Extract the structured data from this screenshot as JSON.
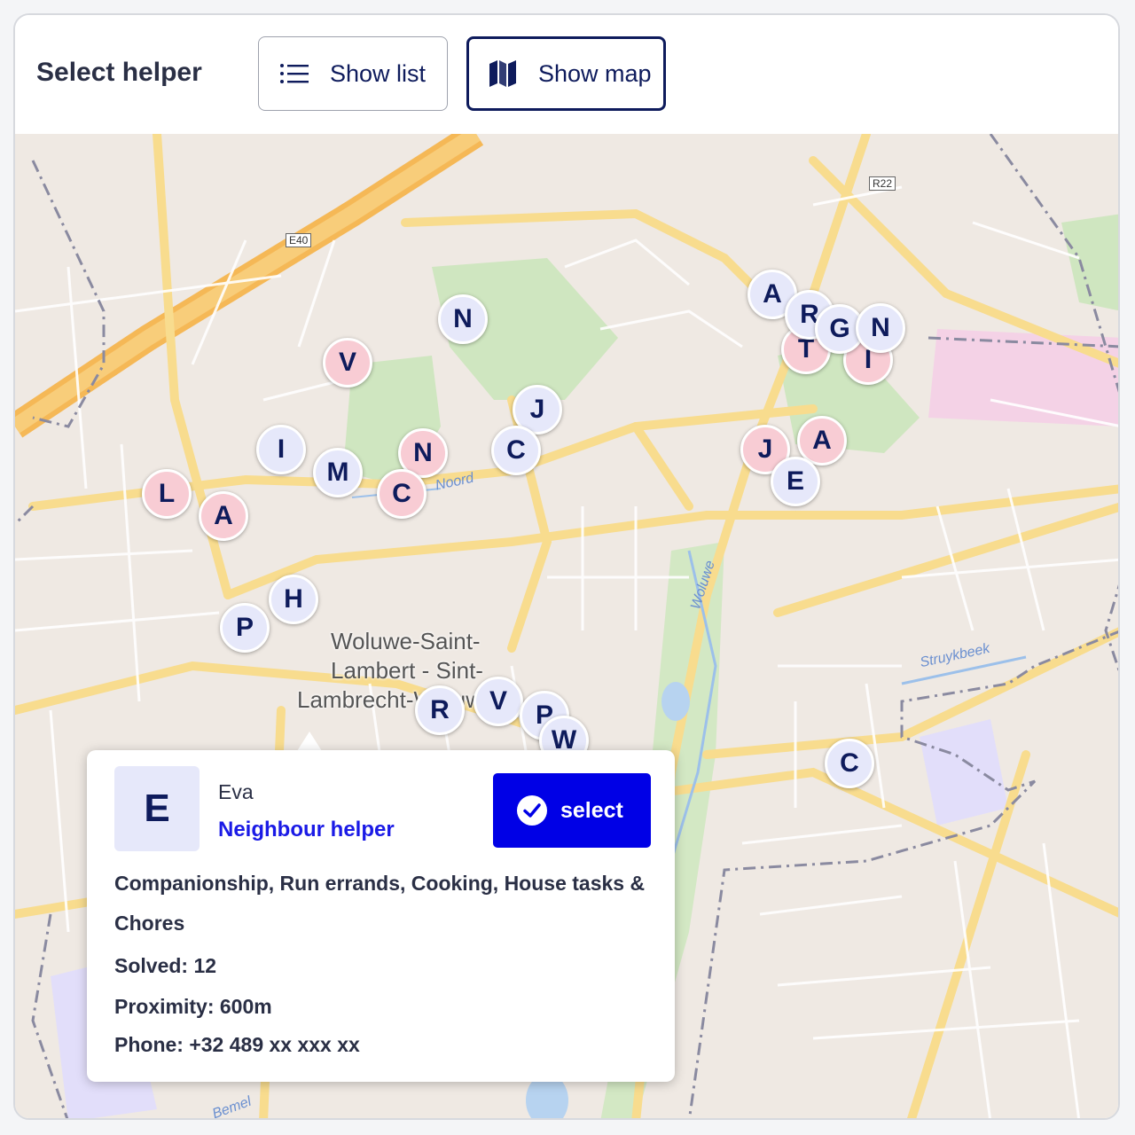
{
  "header": {
    "title": "Select helper",
    "show_list_label": "Show list",
    "show_map_label": "Show map"
  },
  "map": {
    "place_label_line1": "Woluwe-Saint-",
    "place_label_line2": "Lambert - Sint-",
    "place_label_line3": "Lambrecht-Woluwe",
    "road_tags": [
      "E40",
      "R22"
    ],
    "water_labels": [
      "Noord",
      "Woluwe",
      "Struykbeek",
      "Bemel"
    ]
  },
  "markers": [
    {
      "letter": "N",
      "color": "blue"
    },
    {
      "letter": "V",
      "color": "pink"
    },
    {
      "letter": "J",
      "color": "blue"
    },
    {
      "letter": "C",
      "color": "blue"
    },
    {
      "letter": "I",
      "color": "blue"
    },
    {
      "letter": "N",
      "color": "pink"
    },
    {
      "letter": "M",
      "color": "blue"
    },
    {
      "letter": "C",
      "color": "pink"
    },
    {
      "letter": "L",
      "color": "pink"
    },
    {
      "letter": "A",
      "color": "pink"
    },
    {
      "letter": "H",
      "color": "blue"
    },
    {
      "letter": "P",
      "color": "blue"
    },
    {
      "letter": "A",
      "color": "blue"
    },
    {
      "letter": "T",
      "color": "pink"
    },
    {
      "letter": "I",
      "color": "pink"
    },
    {
      "letter": "R",
      "color": "blue"
    },
    {
      "letter": "G",
      "color": "blue"
    },
    {
      "letter": "N",
      "color": "blue"
    },
    {
      "letter": "J",
      "color": "pink"
    },
    {
      "letter": "A",
      "color": "pink"
    },
    {
      "letter": "E",
      "color": "blue"
    },
    {
      "letter": "R",
      "color": "blue"
    },
    {
      "letter": "V",
      "color": "blue"
    },
    {
      "letter": "P",
      "color": "blue"
    },
    {
      "letter": "W",
      "color": "blue"
    },
    {
      "letter": "C",
      "color": "blue"
    }
  ],
  "popup": {
    "avatar_letter": "E",
    "name": "Eva",
    "role": "Neighbour helper",
    "select_label": "select",
    "tasks": "Companionship, Run errands, Cooking, House tasks & Chores",
    "solved": "Solved: 12",
    "proximity": "Proximity: 600m",
    "phone": "Phone: +32 489 xx xxx xx"
  },
  "colors": {
    "brand_navy": "#0e1b5c",
    "select_blue": "#0000e6",
    "role_blue": "#1a1ae6",
    "marker_blue": "#e6e8fa",
    "marker_pink": "#f8ccd4"
  }
}
